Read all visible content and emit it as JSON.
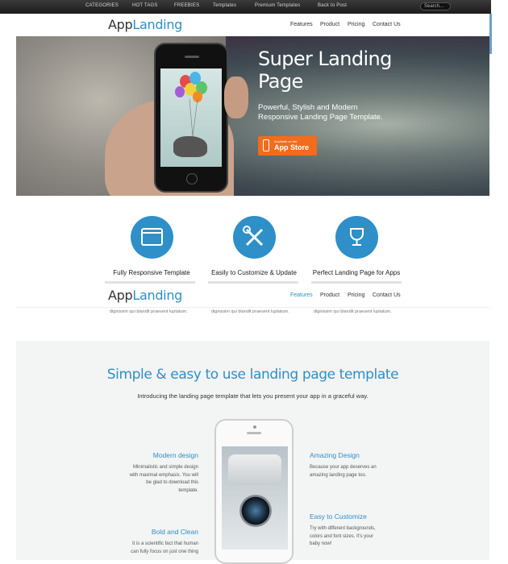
{
  "topbar": {
    "items": [
      "CATEGORIES",
      "HOT TAGS",
      "FREEBIES",
      "Templates",
      "Premium Templates",
      "Back to Post"
    ],
    "search_placeholder": "Search..."
  },
  "header": {
    "logo_app": "App",
    "logo_landing": "Landing",
    "nav": [
      "Features",
      "Product",
      "Pricing",
      "Contact Us"
    ]
  },
  "hero": {
    "title_line1": "Super Landing",
    "title_line2": "Page",
    "subtitle_line1": "Powerful, Stylish and Modern",
    "subtitle_line2": "Responsive Landing Page Template.",
    "appstore_small": "Available on the",
    "appstore_large": "App Store"
  },
  "features": [
    {
      "title": "Fully Responsive Template",
      "icon": "browser-window-icon",
      "text_tail": "dignissim qui blandit praesent luptatum."
    },
    {
      "title": "Easily to Customize & Update",
      "icon": "tools-icon",
      "text_tail": "dignissim qui blandit praesent luptatum."
    },
    {
      "title": "Perfect Landing Page for Apps",
      "icon": "trophy-icon",
      "text_tail": "dignissim qui blandit praesent luptatum."
    }
  ],
  "sticky_header": {
    "logo_app": "App",
    "logo_landing": "Landing",
    "nav": [
      "Features",
      "Product",
      "Pricing",
      "Contact Us"
    ],
    "active": "Features"
  },
  "section2": {
    "title": "Simple & easy to use landing page template",
    "intro": "Introducing the landing page template that lets you present your app in a graceful way.",
    "left": [
      {
        "title": "Modern design",
        "lines": [
          "Minimalistic and simple design",
          "with maximal emphasis. You will",
          "be glad to download this",
          "template."
        ]
      },
      {
        "title": "Bold and Clean",
        "lines": [
          "It is a scientific fact that human",
          "can fully focus on just one thing"
        ]
      }
    ],
    "right": [
      {
        "title": "Amazing Design",
        "lines": [
          "Because your app deserves an",
          "amazing landing page too."
        ]
      },
      {
        "title": "Easy to Customize",
        "lines": [
          "Try with different backgrounds,",
          "colors and font sizes. It's your",
          "baby now!"
        ]
      }
    ]
  },
  "colors": {
    "accent": "#2e8fc9",
    "appstore": "#f26c1c",
    "topbar": "#2a2a2a"
  }
}
